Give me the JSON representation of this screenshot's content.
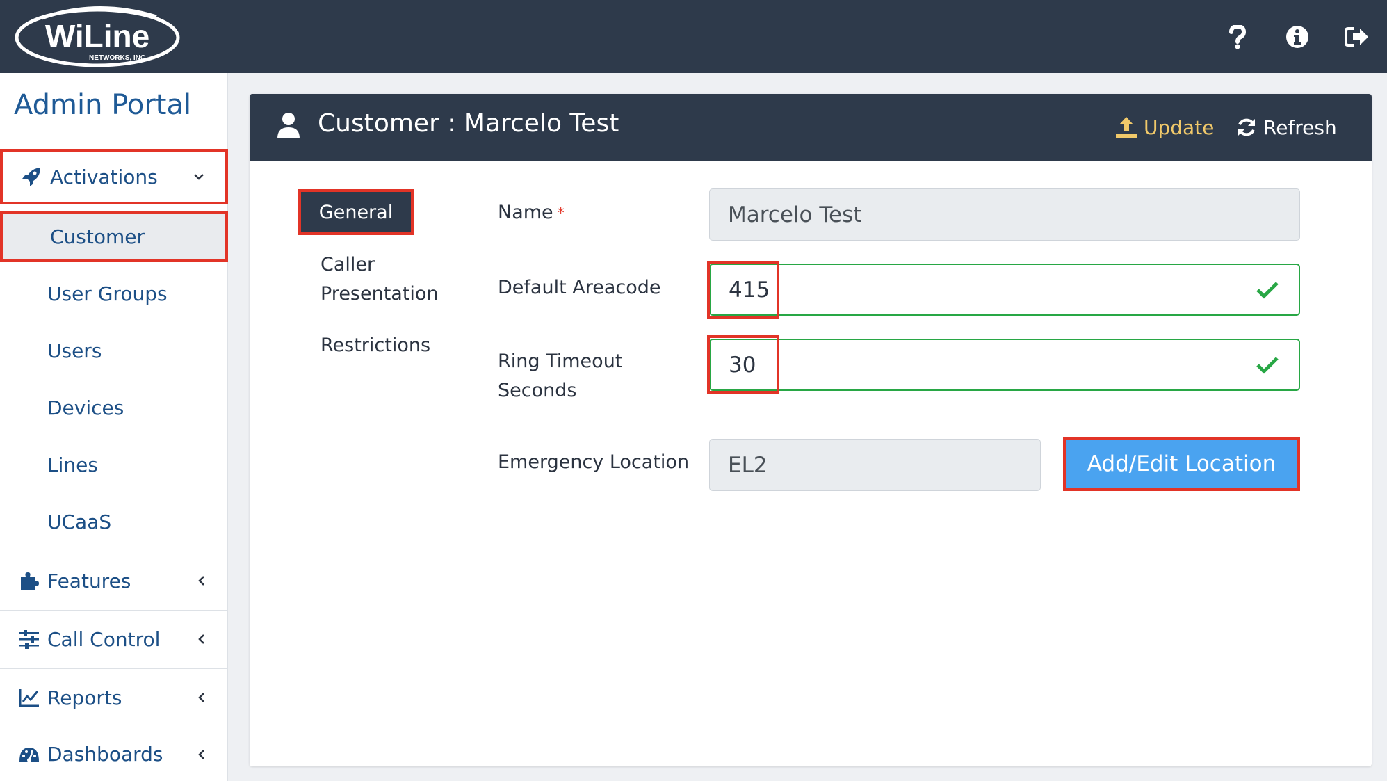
{
  "brand": {
    "logo_main": "WiLine",
    "logo_sub": "NETWORKS, INC."
  },
  "topbar": {
    "help_icon": "question-icon",
    "info_icon": "info-icon",
    "logout_icon": "sign-out-icon"
  },
  "sidebar": {
    "title": "Admin Portal",
    "activations": {
      "label": "Activations",
      "icon": "rocket-icon"
    },
    "sub_items": [
      "Customer",
      "User Groups",
      "Users",
      "Devices",
      "Lines",
      "UCaaS"
    ],
    "sections": [
      {
        "label": "Features",
        "icon": "puzzle-icon"
      },
      {
        "label": "Call Control",
        "icon": "sliders-icon"
      },
      {
        "label": "Reports",
        "icon": "line-chart-icon"
      },
      {
        "label": "Dashboards",
        "icon": "dashboard-icon"
      }
    ]
  },
  "panel": {
    "title": "Customer : Marcelo Test",
    "update_label": "Update",
    "refresh_label": "Refresh"
  },
  "tabs": {
    "general": "General",
    "caller_line1": "Caller",
    "caller_line2": "Presentation",
    "restrictions": "Restrictions"
  },
  "form": {
    "name_label": "Name",
    "required_mark": "*",
    "name_value": "Marcelo Test",
    "areacode_label": "Default Areacode",
    "areacode_value": "415",
    "ring_label_line1": "Ring Timeout",
    "ring_label_line2": "Seconds",
    "ring_value": "30",
    "emergency_label": "Emergency Location",
    "emergency_value": "EL2",
    "location_button": "Add/Edit Location"
  },
  "colors": {
    "dark_navy": "#2e3a4b",
    "link_blue": "#1c4f86",
    "highlight_red": "#e23427",
    "success_green": "#28a745",
    "button_blue": "#4aa3f0",
    "update_gold": "#f1c96a"
  }
}
